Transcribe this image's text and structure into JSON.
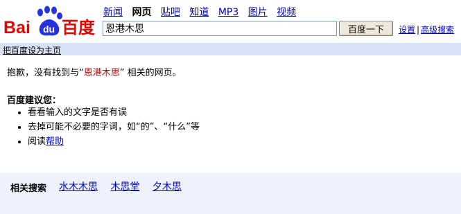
{
  "logo": {
    "text_bai": "Bai",
    "text_du": "du",
    "text_brand": "百度"
  },
  "nav": {
    "items": [
      {
        "label": "新闻",
        "active": false
      },
      {
        "label": "网页",
        "active": true
      },
      {
        "label": "贴吧",
        "active": false
      },
      {
        "label": "知道",
        "active": false
      },
      {
        "label": "MP3",
        "active": false
      },
      {
        "label": "图片",
        "active": false
      },
      {
        "label": "视频",
        "active": false
      }
    ]
  },
  "search": {
    "value": "恩港木思",
    "button_label": "百度一下"
  },
  "top_links": {
    "settings": "设置",
    "separator": "|",
    "advanced": "高级搜索"
  },
  "homebar": {
    "set_homepage": "把百度设为主页"
  },
  "result": {
    "prefix": "抱歉，没有找到与",
    "open_quote": "“",
    "query": "恩港木思",
    "close_quote": "”",
    "suffix": " 相关的网页。"
  },
  "suggestions": {
    "title": "百度建议您：",
    "items": [
      "看看输入的文字是否有误",
      "去掉可能不必要的字词，如“的”、“什么”等"
    ],
    "read_prefix": "阅读",
    "help_link": "帮助"
  },
  "related": {
    "label": "相关搜索",
    "items": [
      "水木木思",
      "木思堂",
      "夕木思"
    ]
  },
  "colors": {
    "brand_red": "#e10602",
    "brand_blue": "#2932e1",
    "link": "#0000cc",
    "homebar_bg": "#d9e1f7",
    "related_bg": "#eff2fa",
    "query_red": "#c60a00"
  }
}
